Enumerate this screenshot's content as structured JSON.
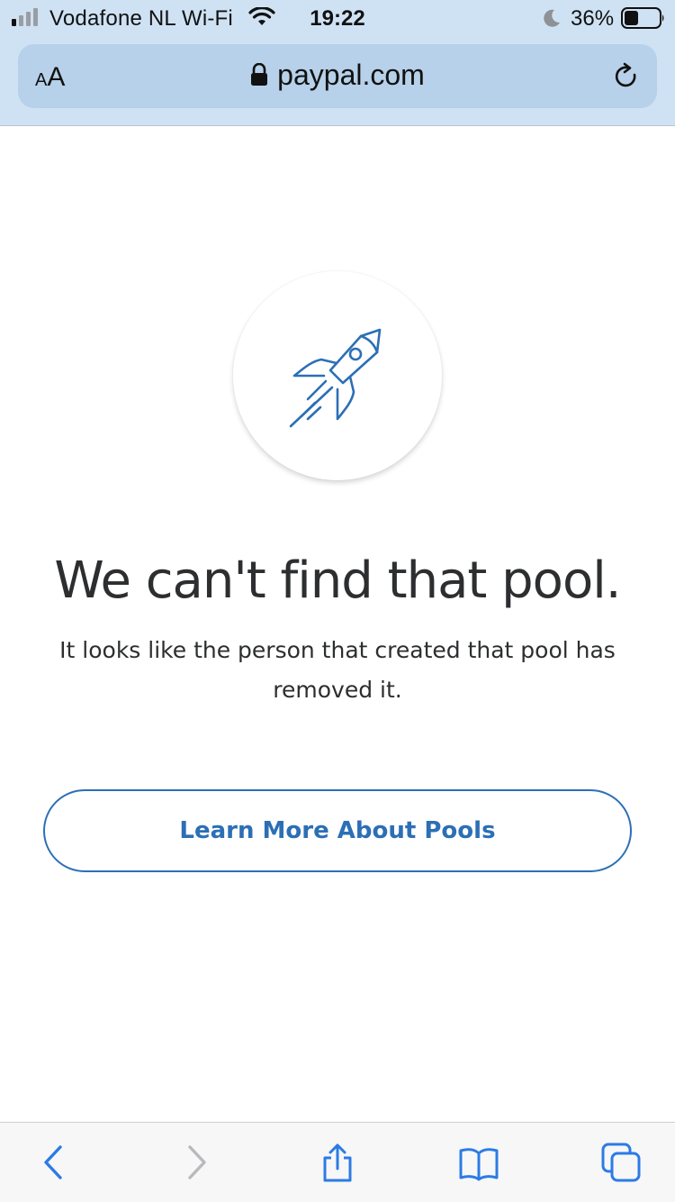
{
  "status_bar": {
    "carrier": "Vodafone NL Wi-Fi",
    "time": "19:22",
    "battery": "36%"
  },
  "url_bar": {
    "text_size_label_small": "A",
    "text_size_label_big": "A",
    "domain": "paypal.com"
  },
  "main": {
    "title": "We can't find that pool.",
    "body": "It looks like the person that created that pool has removed it.",
    "cta_label": "Learn More About Pools"
  },
  "colors": {
    "accent": "#2c6fb5",
    "chrome_bg": "#cfe2f4",
    "url_bar_bg": "#b6d1e9",
    "text": "#2c2e2f",
    "toolbar_icon": "#2c7be5"
  },
  "icons": {
    "hero": "rocket-icon",
    "toolbar": [
      "back-icon",
      "forward-icon",
      "share-icon",
      "bookmarks-icon",
      "tabs-icon"
    ]
  }
}
